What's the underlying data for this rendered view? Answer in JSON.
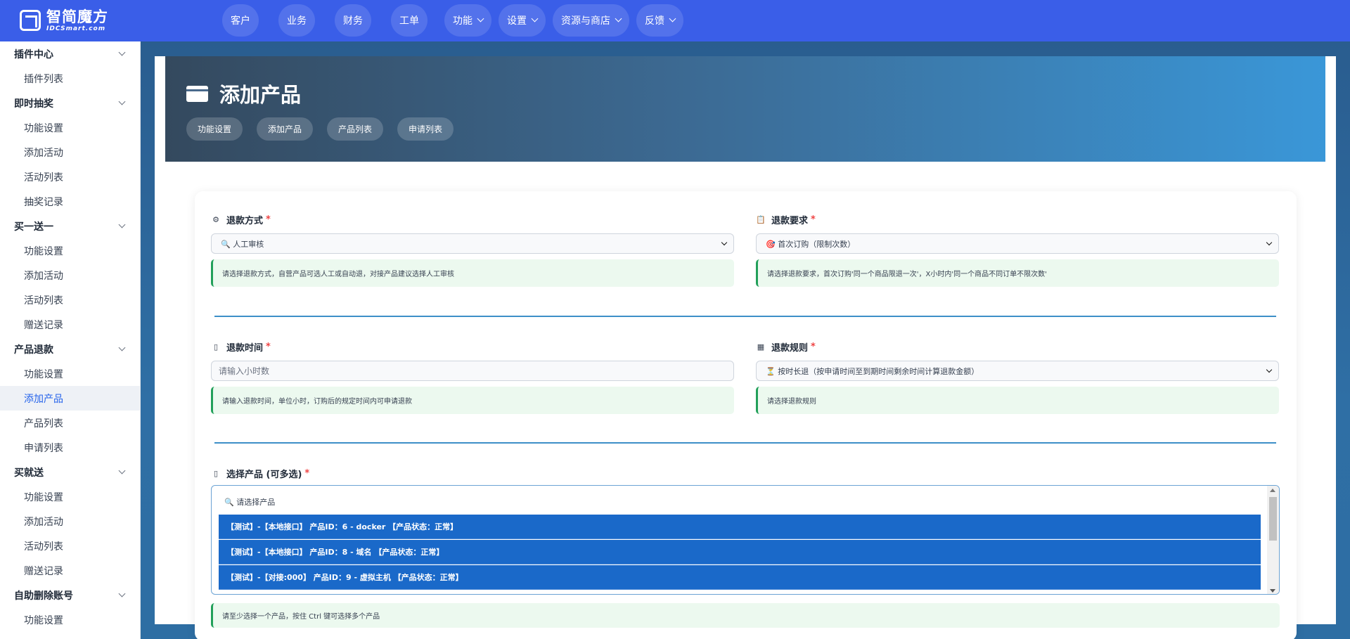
{
  "logo": {
    "cn": "智简魔方",
    "en": "IDCSmart.com"
  },
  "nav": [
    {
      "label": "客户",
      "dropdown": false
    },
    {
      "label": "业务",
      "dropdown": false
    },
    {
      "label": "财务",
      "dropdown": false
    },
    {
      "label": "工单",
      "dropdown": false
    },
    {
      "label": "功能",
      "dropdown": true
    },
    {
      "label": "设置",
      "dropdown": true
    },
    {
      "label": "资源与商店",
      "dropdown": true
    },
    {
      "label": "反馈",
      "dropdown": true
    }
  ],
  "sidebar": {
    "groups": [
      {
        "label": "插件中心",
        "items": [
          "插件列表"
        ]
      },
      {
        "label": "即时抽奖",
        "items": [
          "功能设置",
          "添加活动",
          "活动列表",
          "抽奖记录"
        ]
      },
      {
        "label": "买一送一",
        "items": [
          "功能设置",
          "添加活动",
          "活动列表",
          "赠送记录"
        ]
      },
      {
        "label": "产品退款",
        "items": [
          "功能设置",
          "添加产品",
          "产品列表",
          "申请列表"
        ]
      },
      {
        "label": "买就送",
        "items": [
          "功能设置",
          "添加活动",
          "活动列表",
          "赠送记录"
        ]
      },
      {
        "label": "自助删除账号",
        "items": [
          "功能设置"
        ]
      }
    ],
    "active": "添加产品"
  },
  "hero": {
    "title": "添加产品",
    "tabs": [
      "功能设置",
      "添加产品",
      "产品列表",
      "申请列表"
    ]
  },
  "form": {
    "refund_method": {
      "label": "退款方式",
      "icon": "gear-icon",
      "value": "🔍 人工审核",
      "help": "请选择退款方式，自营产品可选人工或自动退，对接产品建议选择人工审核"
    },
    "refund_requirement": {
      "label": "退款要求",
      "icon": "clipboard-icon",
      "value": "🎯 首次订购（限制次数）",
      "help": "请选择退款要求，首次订购'同一个商品限退一次'，X小时内'同一个商品不同订单不限次数'"
    },
    "refund_time": {
      "label": "退款时间",
      "icon": "clock-icon",
      "placeholder": "请输入小时数",
      "help": "请输入退款时间，单位小时，订购后的规定时间内可申请退款"
    },
    "refund_rule": {
      "label": "退款规则",
      "icon": "rule-icon",
      "value": "⏳ 按时长退（按申请时间至到期时间剩余时间计算退款金额）",
      "help": "请选择退款规则"
    },
    "product_select": {
      "label": "选择产品 (可多选)",
      "icon": "box-icon",
      "search_placeholder": "🔍 请选择产品",
      "options": [
        "【测试】-【本地接口】 产品ID：6 - docker 【产品状态：正常】",
        "【测试】-【本地接口】 产品ID：8 - 域名 【产品状态：正常】",
        "【测试】-【对接:000】 产品ID：9 - 虚拟主机 【产品状态：正常】"
      ],
      "help": "请至少选择一个产品，按住 Ctrl 键可选择多个产品"
    },
    "required_mark": "*"
  }
}
